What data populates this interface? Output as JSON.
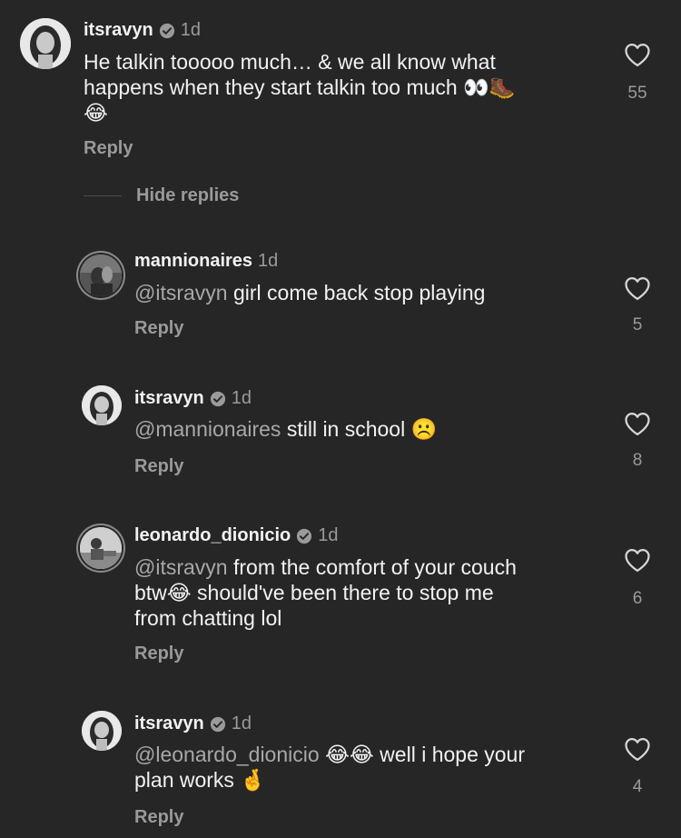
{
  "comments": [
    {
      "username": "itsravyn",
      "verified": true,
      "time": "1d",
      "mention": "",
      "text_lines": [
        "He talkin tooooo much… & we all know what",
        "happens when they start talkin too much 👀🥾",
        "😂"
      ],
      "reply_label": "Reply",
      "likes": "55"
    },
    {
      "username": "mannionaires",
      "verified": false,
      "time": "1d",
      "mention": "@itsravyn",
      "text_lines": [
        " girl come back stop playing"
      ],
      "reply_label": "Reply",
      "likes": "5"
    },
    {
      "username": "itsravyn",
      "verified": true,
      "time": "1d",
      "mention": "@mannionaires",
      "text_lines": [
        " still in school ☹️"
      ],
      "reply_label": "Reply",
      "likes": "8"
    },
    {
      "username": "leonardo_dionicio",
      "verified": true,
      "time": "1d",
      "mention": "@itsravyn",
      "text_lines": [
        " from the comfort of your couch",
        "btw😂 should've been there to stop me",
        "from chatting lol"
      ],
      "reply_label": "Reply",
      "likes": "6"
    },
    {
      "username": "itsravyn",
      "verified": true,
      "time": "1d",
      "mention": "@leonardo_dionicio",
      "text_lines": [
        " 😂😂 well i hope your",
        "plan works 🤞"
      ],
      "reply_label": "Reply",
      "likes": "4"
    }
  ],
  "hide_replies_label": "Hide replies",
  "icons": {
    "like": "heart-outline-icon",
    "verified": "verified-badge-icon"
  }
}
